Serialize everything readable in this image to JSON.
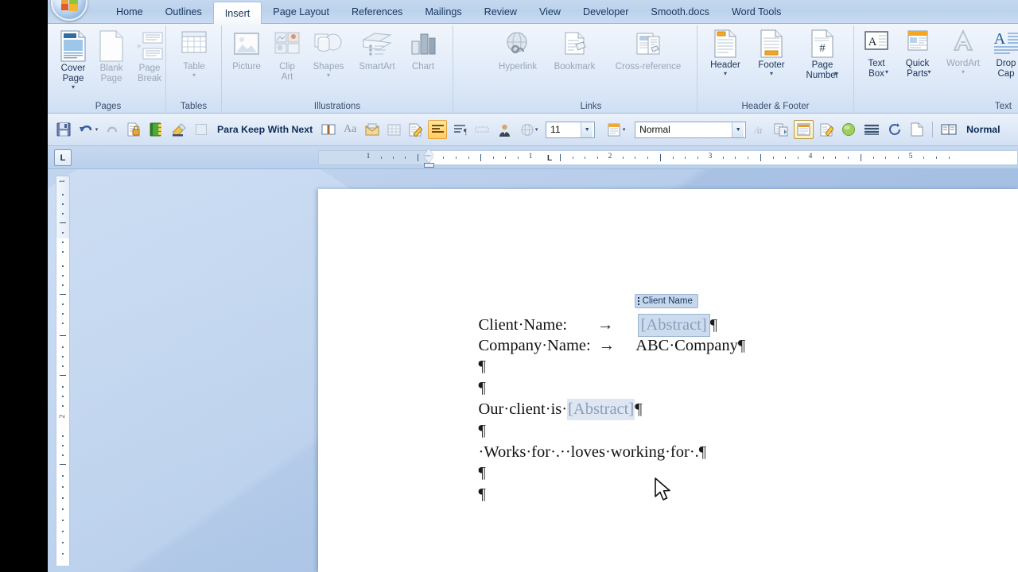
{
  "app": {
    "office_button": "office-orb",
    "tabs": [
      {
        "label": "Home",
        "active": false
      },
      {
        "label": "Outlines",
        "active": false
      },
      {
        "label": "Insert",
        "active": true
      },
      {
        "label": "Page Layout",
        "active": false
      },
      {
        "label": "References",
        "active": false
      },
      {
        "label": "Mailings",
        "active": false
      },
      {
        "label": "Review",
        "active": false
      },
      {
        "label": "View",
        "active": false
      },
      {
        "label": "Developer",
        "active": false
      },
      {
        "label": "Smooth.docs",
        "active": false
      },
      {
        "label": "Word Tools",
        "active": false
      }
    ]
  },
  "ribbon": {
    "groups": [
      {
        "name": "Pages",
        "label": "Pages",
        "buttons": [
          {
            "label": "Cover\nPage",
            "icon": "cover-page-icon",
            "caret": true,
            "dim": false
          },
          {
            "label": "Blank\nPage",
            "icon": "blank-page-icon",
            "caret": false,
            "dim": true
          },
          {
            "label": "Page\nBreak",
            "icon": "page-break-icon",
            "caret": false,
            "dim": true
          }
        ]
      },
      {
        "name": "Tables",
        "label": "Tables",
        "buttons": [
          {
            "label": "Table",
            "icon": "table-icon",
            "caret": true,
            "dim": true
          }
        ]
      },
      {
        "name": "Illustrations",
        "label": "Illustrations",
        "buttons": [
          {
            "label": "Picture",
            "icon": "picture-icon",
            "caret": false,
            "dim": true
          },
          {
            "label": "Clip\nArt",
            "icon": "clip-art-icon",
            "caret": false,
            "dim": true
          },
          {
            "label": "Shapes",
            "icon": "shapes-icon",
            "caret": true,
            "dim": true
          },
          {
            "label": "SmartArt",
            "icon": "smartart-icon",
            "caret": false,
            "dim": true
          },
          {
            "label": "Chart",
            "icon": "chart-icon",
            "caret": false,
            "dim": true
          }
        ]
      },
      {
        "name": "Links",
        "label": "Links",
        "buttons": [
          {
            "label": "Hyperlink",
            "icon": "hyperlink-icon",
            "caret": false,
            "dim": true
          },
          {
            "label": "Bookmark",
            "icon": "bookmark-icon",
            "caret": false,
            "dim": true
          },
          {
            "label": "Cross-reference",
            "icon": "cross-reference-icon",
            "caret": false,
            "dim": true
          }
        ]
      },
      {
        "name": "Header & Footer",
        "label": "Header & Footer",
        "buttons": [
          {
            "label": "Header",
            "icon": "header-icon",
            "caret": true,
            "dim": false
          },
          {
            "label": "Footer",
            "icon": "footer-icon",
            "caret": true,
            "dim": false
          },
          {
            "label": "Page\nNumber",
            "icon": "page-number-icon",
            "caret": true,
            "dim": false
          }
        ]
      },
      {
        "name": "Text",
        "label": "Text",
        "buttons": [
          {
            "label": "Text\nBox",
            "icon": "text-box-icon",
            "caret": true,
            "dim": false
          },
          {
            "label": "Quick\nParts",
            "icon": "quick-parts-icon",
            "caret": true,
            "dim": false
          },
          {
            "label": "WordArt",
            "icon": "wordart-icon",
            "caret": true,
            "dim": true
          },
          {
            "label": "Drop\nCap",
            "icon": "drop-cap-icon",
            "caret": false,
            "dim": false
          }
        ]
      }
    ]
  },
  "toolbar": {
    "items": [
      {
        "name": "save-button",
        "icon": "floppy-disk-icon",
        "kind": "icon"
      },
      {
        "name": "undo-button",
        "icon": "undo-arrow-icon",
        "kind": "icon-caret"
      },
      {
        "name": "redo-button",
        "icon": "redo-arrow-icon",
        "kind": "icon"
      },
      {
        "name": "protect-document-button",
        "icon": "lock-document-icon",
        "kind": "icon"
      },
      {
        "name": "green-book-button",
        "icon": "green-book-icon",
        "kind": "icon"
      },
      {
        "name": "highlight-brush-button",
        "icon": "highlighter-icon",
        "kind": "icon"
      },
      {
        "name": "empty-toggle-button",
        "icon": "empty-square-icon",
        "kind": "icon"
      }
    ],
    "style_button_label": "Para Keep With Next",
    "items2": [
      {
        "name": "reading-layout-button",
        "icon": "open-book-icon"
      },
      {
        "name": "change-case-button",
        "icon": "change-case-icon"
      },
      {
        "name": "envelope-button",
        "icon": "envelope-icon"
      },
      {
        "name": "insert-table-button",
        "icon": "grid-table-icon"
      },
      {
        "name": "format-painter-button",
        "icon": "format-painter-icon"
      },
      {
        "name": "align-left-button",
        "icon": "align-left-icon"
      },
      {
        "name": "show-marks-button",
        "icon": "paragraph-marks-icon"
      },
      {
        "name": "text-field-button",
        "icon": "text-field-icon"
      },
      {
        "name": "author-button",
        "icon": "person-icon"
      },
      {
        "name": "translate-button",
        "icon": "globe-translate-icon"
      }
    ],
    "font_size": "11",
    "style_name": "Normal",
    "items3": [
      {
        "name": "no-format-button",
        "icon": "no-format-icon"
      },
      {
        "name": "copy-format-button",
        "icon": "copy-format-icon"
      },
      {
        "name": "content-control-button",
        "icon": "content-control-icon"
      },
      {
        "name": "styles-button",
        "icon": "styles-pane-icon"
      },
      {
        "name": "green-circle-button",
        "icon": "green-circle-icon"
      },
      {
        "name": "lines-button",
        "icon": "stacked-lines-icon"
      },
      {
        "name": "refresh-button",
        "icon": "refresh-arrows-icon"
      },
      {
        "name": "new-doc-button",
        "icon": "blank-doc-icon"
      },
      {
        "name": "read-mode-button",
        "icon": "book-open-icon"
      }
    ],
    "end_label": "Normal"
  },
  "ruler": {
    "tab_stop_indicator": "L",
    "horizontal_numbers": [
      "1",
      "2",
      "3",
      "4",
      "5"
    ],
    "custom_tab_stop": "L",
    "vertical_numbers": [
      "1",
      "2"
    ]
  },
  "document": {
    "lines": [
      {
        "type": "labeled-control",
        "label": "Client·Name:",
        "tab": "→",
        "control_tag": "Client Name",
        "control_value": "[Abstract]",
        "pilcrow": "¶"
      },
      {
        "type": "labeled-text",
        "label": "Company·Name:",
        "tab": "→",
        "value": "ABC·Company",
        "pilcrow": "¶"
      },
      {
        "type": "empty",
        "pilcrow": "¶"
      },
      {
        "type": "empty",
        "pilcrow": "¶"
      },
      {
        "type": "inline-control",
        "prefix": "Our·client·is·",
        "control_value": "[Abstract]",
        "pilcrow": "¶"
      },
      {
        "type": "empty",
        "pilcrow": "¶"
      },
      {
        "type": "plain",
        "text": "·Works·for·.··loves·working·for·.",
        "pilcrow": "¶"
      },
      {
        "type": "empty",
        "pilcrow": "¶"
      },
      {
        "type": "empty",
        "pilcrow": "¶"
      }
    ]
  },
  "colors": {
    "ribbon_bg": "#e6eefa",
    "tab_active_bg": "#ffffff",
    "tab_text": "#17365d",
    "workarea_bg": "#b7cdea",
    "page_bg": "#ffffff",
    "content_control_bg": "#ccdcee",
    "content_control_tag_bg": "#c6d7ec",
    "placeholder_text": "#8a9dbb",
    "highlight_orange": "#ffcf5e"
  }
}
